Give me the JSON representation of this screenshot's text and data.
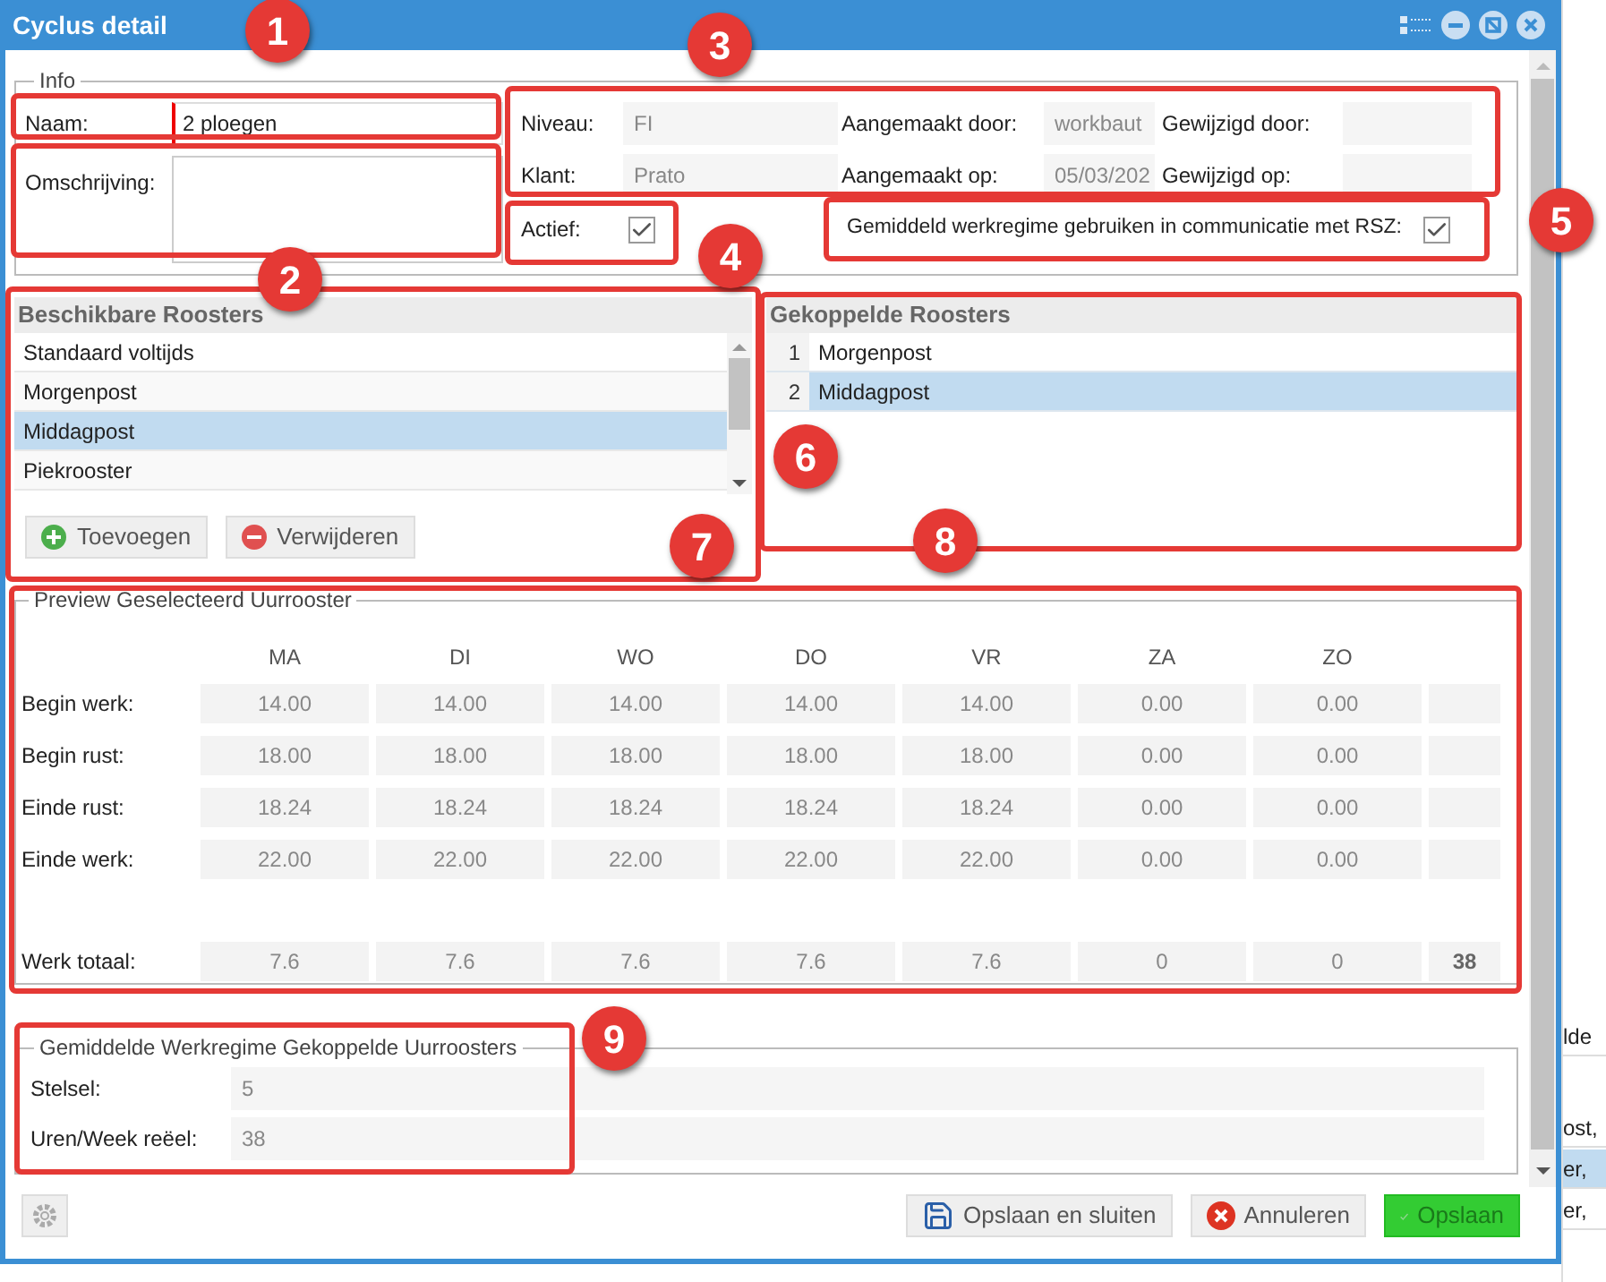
{
  "window": {
    "title": "Cyclus detail"
  },
  "info": {
    "legend": "Info",
    "naam": {
      "label": "Naam:",
      "value": "2 ploegen"
    },
    "omschrijving": {
      "label": "Omschrijving:"
    },
    "meta": [
      {
        "label": "Niveau:",
        "value": "FI"
      },
      {
        "label": "Aangemaakt door:",
        "value": "workbaut"
      },
      {
        "label": "Gewijzigd door:"
      },
      {
        "label": "Klant:",
        "value": "Prato"
      },
      {
        "label": "Aangemaakt op:",
        "value": "05/03/202"
      },
      {
        "label": "Gewijzigd op:"
      }
    ],
    "actief": {
      "label": "Actief:",
      "checked": true
    },
    "rsz": {
      "label": "Gemiddeld werkregime gebruiken in communicatie met RSZ:",
      "checked": true
    }
  },
  "beschikbare": {
    "title": "Beschikbare Roosters",
    "items": [
      {
        "label": "Standaard voltijds",
        "selected": false
      },
      {
        "label": "Morgenpost",
        "selected": false
      },
      {
        "label": "Middagpost",
        "selected": true
      },
      {
        "label": "Piekrooster",
        "selected": false
      }
    ],
    "buttons": [
      {
        "kind": "add",
        "label": "Toevoegen"
      },
      {
        "kind": "remove",
        "label": "Verwijderen"
      }
    ]
  },
  "gekoppelde": {
    "title": "Gekoppelde Roosters",
    "rows": [
      {
        "index": "1",
        "label": "Morgenpost",
        "selected": false
      },
      {
        "index": "2",
        "label": "Middagpost",
        "selected": true
      }
    ]
  },
  "preview": {
    "legend": "Preview Geselecteerd Uurrooster",
    "days": [
      "MA",
      "DI",
      "WO",
      "DO",
      "VR",
      "ZA",
      "ZO"
    ],
    "rows": [
      {
        "label": "Begin werk:",
        "values": [
          "14.00",
          "14.00",
          "14.00",
          "14.00",
          "14.00",
          "0.00",
          "0.00"
        ]
      },
      {
        "label": "Begin rust:",
        "values": [
          "18.00",
          "18.00",
          "18.00",
          "18.00",
          "18.00",
          "0.00",
          "0.00"
        ]
      },
      {
        "label": "Einde rust:",
        "values": [
          "18.24",
          "18.24",
          "18.24",
          "18.24",
          "18.24",
          "0.00",
          "0.00"
        ]
      },
      {
        "label": "Einde werk:",
        "values": [
          "22.00",
          "22.00",
          "22.00",
          "22.00",
          "22.00",
          "0.00",
          "0.00"
        ]
      }
    ],
    "total": {
      "label": "Werk totaal:",
      "values": [
        "7.6",
        "7.6",
        "7.6",
        "7.6",
        "7.6",
        "0",
        "0"
      ],
      "sum": "38"
    }
  },
  "gemiddelde": {
    "legend": "Gemiddelde Werkregime Gekoppelde Uurroosters",
    "fields": [
      {
        "label": "Stelsel:",
        "value": "5"
      },
      {
        "label": "Uren/Week reëel:",
        "value": "38"
      }
    ]
  },
  "footer": {
    "buttons": [
      {
        "kind": "save-close",
        "label": "Opslaan en sluiten"
      },
      {
        "kind": "cancel",
        "label": "Annuleren"
      },
      {
        "kind": "save",
        "label": "Opslaan"
      }
    ]
  },
  "background_rows": [
    {
      "label": "lde",
      "selected": false
    },
    {
      "label": "ost,",
      "selected": false
    },
    {
      "label": "er,",
      "selected": true
    },
    {
      "label": "er,",
      "selected": false
    }
  ],
  "annotations": [
    "1",
    "2",
    "3",
    "4",
    "5",
    "6",
    "7",
    "8",
    "9"
  ]
}
